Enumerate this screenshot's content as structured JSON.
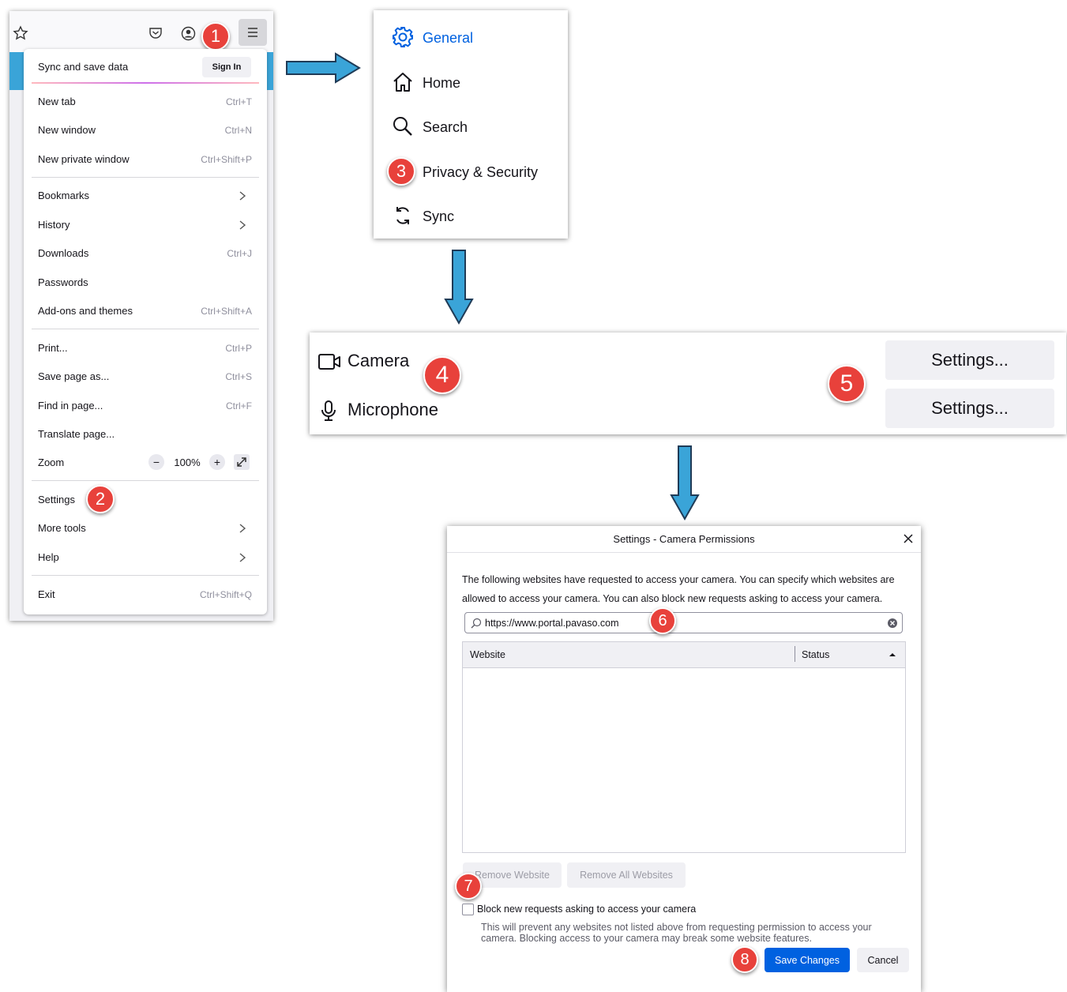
{
  "menu": {
    "sync_label": "Sync and save data",
    "sign_in": "Sign In",
    "items": [
      {
        "label": "New tab",
        "shortcut": "Ctrl+T"
      },
      {
        "label": "New window",
        "shortcut": "Ctrl+N"
      },
      {
        "label": "New private window",
        "shortcut": "Ctrl+Shift+P"
      },
      {
        "label": "Bookmarks",
        "shortcut": ""
      },
      {
        "label": "History",
        "shortcut": ""
      },
      {
        "label": "Downloads",
        "shortcut": "Ctrl+J"
      },
      {
        "label": "Passwords",
        "shortcut": ""
      },
      {
        "label": "Add-ons and themes",
        "shortcut": "Ctrl+Shift+A"
      },
      {
        "label": "Print...",
        "shortcut": "Ctrl+P"
      },
      {
        "label": "Save page as...",
        "shortcut": "Ctrl+S"
      },
      {
        "label": "Find in page...",
        "shortcut": "Ctrl+F"
      },
      {
        "label": "Translate page...",
        "shortcut": ""
      },
      {
        "label": "Zoom",
        "shortcut": ""
      },
      {
        "label": "Settings",
        "shortcut": ""
      },
      {
        "label": "More tools",
        "shortcut": ""
      },
      {
        "label": "Help",
        "shortcut": ""
      },
      {
        "label": "Exit",
        "shortcut": "Ctrl+Shift+Q"
      }
    ],
    "zoom_minus": "−",
    "zoom_value": "100%",
    "zoom_plus": "+"
  },
  "categories": {
    "general": "General",
    "home": "Home",
    "search": "Search",
    "privacy": "Privacy & Security",
    "sync": "Sync"
  },
  "permissions": {
    "camera": "Camera",
    "microphone": "Microphone",
    "settings_button": "Settings..."
  },
  "dialog": {
    "title": "Settings - Camera Permissions",
    "description": "The following websites have requested to access your camera. You can specify which websites are allowed to access your camera. You can also block new requests asking to access your camera.",
    "search_value": "https://www.portal.pavaso.com",
    "col_website": "Website",
    "col_status": "Status",
    "remove_website": "Remove Website",
    "remove_all": "Remove All Websites",
    "block_label": "Block new requests asking to access your camera",
    "block_note": "This will prevent any websites not listed above from requesting permission to access your camera. Blocking access to your camera may break some website features.",
    "save": "Save Changes",
    "cancel": "Cancel"
  },
  "badges": [
    "1",
    "2",
    "3",
    "4",
    "5",
    "6",
    "7",
    "8"
  ],
  "colors": {
    "accent": "#0061e0",
    "badge": "#e8413b",
    "arrow": "#3aa4d8"
  }
}
